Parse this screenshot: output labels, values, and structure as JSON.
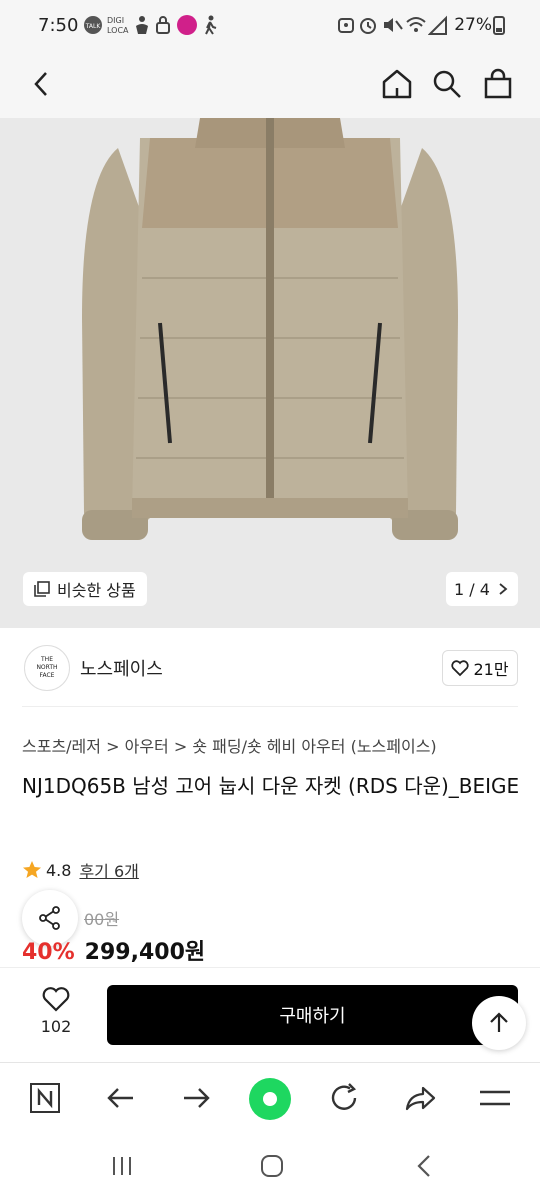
{
  "status_bar": {
    "time": "7:50",
    "battery": "27%",
    "indicators": [
      "talk-icon",
      "digi-loca-icon",
      "accessibility-icon",
      "lock-icon",
      "app-badge-icon",
      "walking-icon"
    ],
    "system_icons": [
      "alarm-icon",
      "mute-icon",
      "wifi-icon",
      "signal-icon",
      "battery-icon"
    ]
  },
  "app_bar": {
    "icons": [
      "back-icon",
      "home-icon",
      "search-icon",
      "bag-icon"
    ]
  },
  "gallery": {
    "similar_label": "비슷한 상품",
    "pager": "1 / 4",
    "colors": {
      "jacket": "#b6ab93",
      "yoke": "#b19f84",
      "background": "#e9e9e9"
    }
  },
  "brand": {
    "logo_text": "THE NORTH FACE",
    "name": "노스페이스",
    "likes": "21만"
  },
  "product": {
    "breadcrumb": [
      "스포츠/레저",
      "아우터",
      "숏 패딩/숏 헤비 아우터 (노스페이스)"
    ],
    "title": "NJ1DQ65B 남성 고어 눕시 다운 자켓 (RDS 다운)_BEIGE",
    "rating": "4.8",
    "reviews": "후기 6개",
    "original_price_fragment": "00원",
    "discount": "40%",
    "price": "299,400원"
  },
  "buy_bar": {
    "wish_count": "102",
    "buy_label": "구매하기"
  },
  "browser_bar": {
    "icons": [
      "naver-n-icon",
      "arrow-left-icon",
      "arrow-right-icon",
      "green-dot-icon",
      "refresh-icon",
      "share-forward-icon",
      "menu-icon"
    ],
    "accent": "#1ed760"
  },
  "nav_bar": {
    "icons": [
      "recents-icon",
      "home-circle-icon",
      "back-chevron-icon"
    ]
  }
}
